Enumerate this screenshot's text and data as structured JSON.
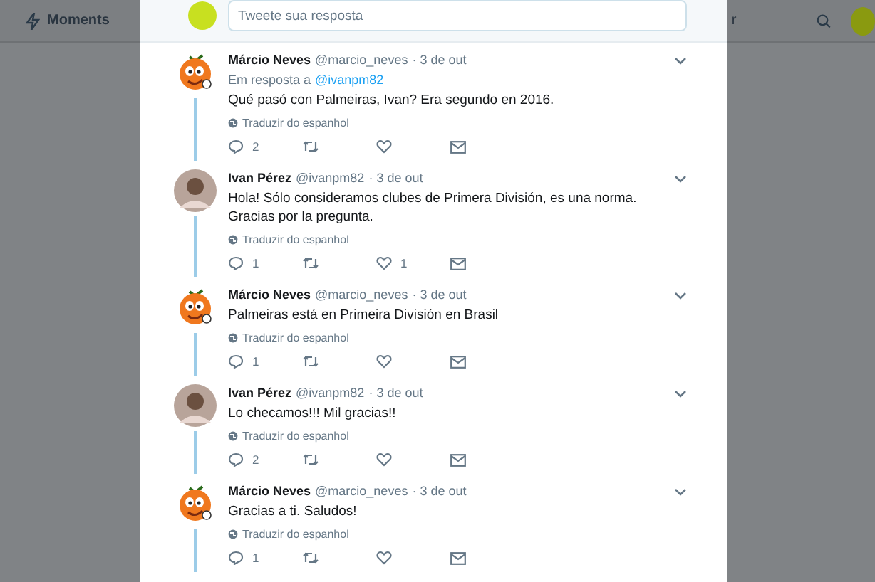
{
  "nav": {
    "items": [
      {
        "label": "Moments"
      }
    ],
    "cut_text": "r"
  },
  "reply_box": {
    "placeholder": "Tweete sua resposta"
  },
  "tweets": [
    {
      "kind": "cartoon",
      "name": "Márcio Neves",
      "handle": "@marcio_neves",
      "date": "· 3 de out",
      "reply_to": {
        "prefix": "Em resposta a",
        "handle": "@ivanpm82"
      },
      "text": "Qué pasó con Palmeiras, Ivan? Era segundo en 2016.",
      "translate": "Traduzir do espanhol",
      "replies": "2"
    },
    {
      "kind": "photo",
      "name": "Ivan Pérez",
      "handle": "@ivanpm82",
      "date": "· 3 de out",
      "text": "Hola! Sólo consideramos clubes de Primera División, es una norma. Gracias por la pregunta.",
      "translate": "Traduzir do espanhol",
      "replies": "1",
      "likes": "1"
    },
    {
      "kind": "cartoon",
      "name": "Márcio Neves",
      "handle": "@marcio_neves",
      "date": "· 3 de out",
      "text": "Palmeiras está en Primeira División en Brasil",
      "translate": "Traduzir do espanhol",
      "replies": "1"
    },
    {
      "kind": "photo",
      "name": "Ivan Pérez",
      "handle": "@ivanpm82",
      "date": "· 3 de out",
      "text": "Lo checamos!!! Mil gracias!!",
      "translate": "Traduzir do espanhol",
      "replies": "2"
    },
    {
      "kind": "cartoon",
      "name": "Márcio Neves",
      "handle": "@marcio_neves",
      "date": "· 3 de out",
      "text": "Gracias a ti. Saludos!",
      "translate": "Traduzir do espanhol",
      "replies": "1"
    }
  ]
}
